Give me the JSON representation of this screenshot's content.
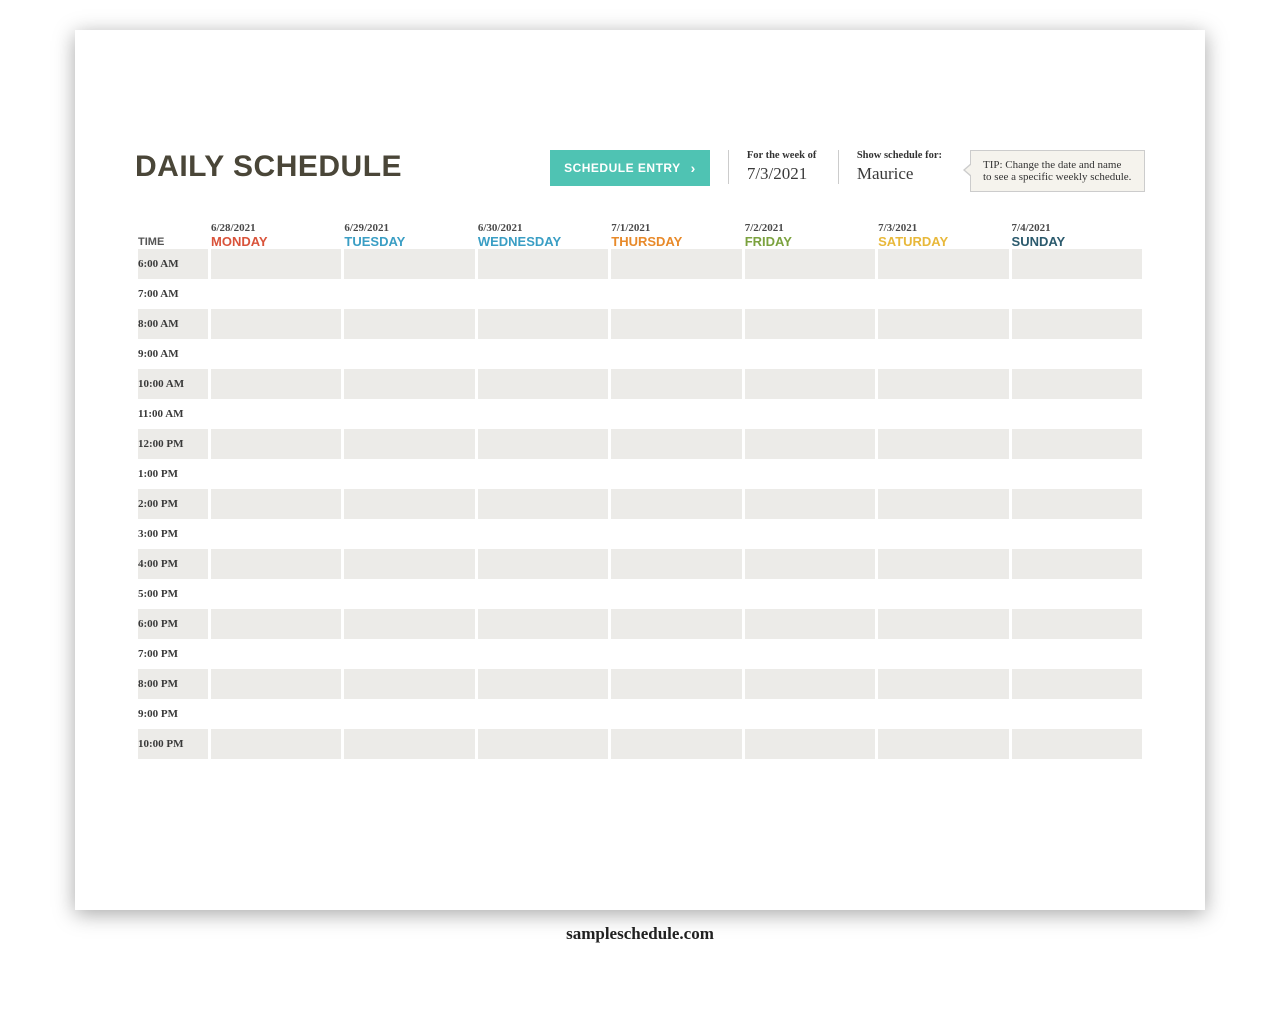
{
  "title": "DAILY SCHEDULE",
  "schedule_entry_label": "SCHEDULE ENTRY",
  "week_block": {
    "label": "For the week of",
    "value": "7/3/2021"
  },
  "person_block": {
    "label": "Show schedule for:",
    "value": "Maurice"
  },
  "tip": "TIP: Change the date and name to see a specific weekly schedule.",
  "time_header": "TIME",
  "days": [
    {
      "date": "6/28/2021",
      "name": "MONDAY",
      "cls": "c-mon"
    },
    {
      "date": "6/29/2021",
      "name": "TUESDAY",
      "cls": "c-tue"
    },
    {
      "date": "6/30/2021",
      "name": "WEDNESDAY",
      "cls": "c-wed"
    },
    {
      "date": "7/1/2021",
      "name": "THURSDAY",
      "cls": "c-thu"
    },
    {
      "date": "7/2/2021",
      "name": "FRIDAY",
      "cls": "c-fri"
    },
    {
      "date": "7/3/2021",
      "name": "SATURDAY",
      "cls": "c-sat"
    },
    {
      "date": "7/4/2021",
      "name": "SUNDAY",
      "cls": "c-sun"
    }
  ],
  "times": [
    "6:00 AM",
    "7:00 AM",
    "8:00 AM",
    "9:00 AM",
    "10:00 AM",
    "11:00 AM",
    "12:00 PM",
    "1:00 PM",
    "2:00 PM",
    "3:00 PM",
    "4:00 PM",
    "5:00 PM",
    "6:00 PM",
    "7:00 PM",
    "8:00 PM",
    "9:00 PM",
    "10:00 PM"
  ],
  "footer": "sampleschedule.com"
}
